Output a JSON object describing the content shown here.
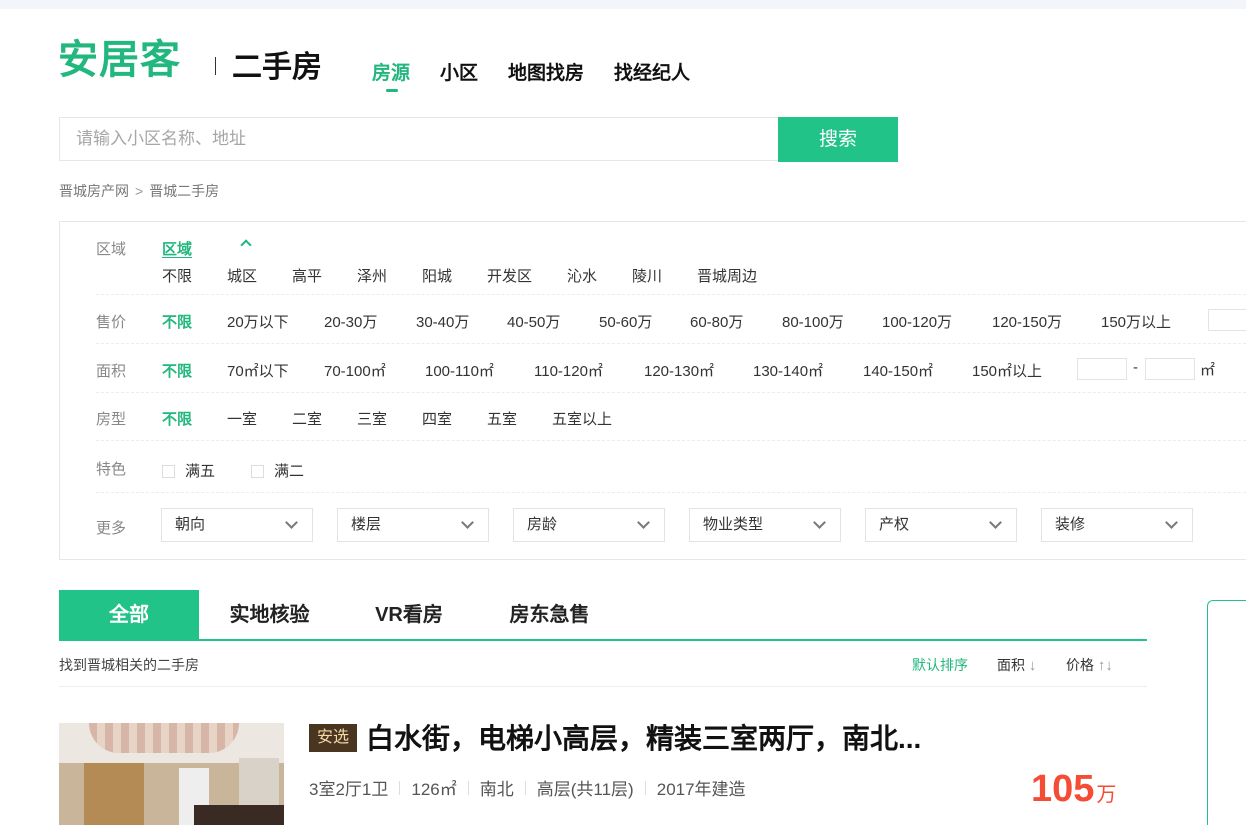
{
  "header": {
    "logo": "安居客",
    "subtitle": "二手房",
    "nav": [
      {
        "label": "房源",
        "active": true
      },
      {
        "label": "小区",
        "active": false
      },
      {
        "label": "地图找房",
        "active": false
      },
      {
        "label": "找经纪人",
        "active": false
      }
    ]
  },
  "search": {
    "placeholder": "请输入小区名称、地址",
    "button_label": "搜索"
  },
  "breadcrumb": [
    "晋城房产网",
    "晋城二手房"
  ],
  "breadcrumb_sep": ">",
  "filters": {
    "region": {
      "label": "区域",
      "tab": "区域",
      "options": [
        "不限",
        "城区",
        "高平",
        "泽州",
        "阳城",
        "开发区",
        "沁水",
        "陵川",
        "晋城周边"
      ]
    },
    "price": {
      "label": "售价",
      "options": [
        "不限",
        "20万以下",
        "20-30万",
        "30-40万",
        "40-50万",
        "50-60万",
        "60-80万",
        "80-100万",
        "100-120万",
        "120-150万",
        "150万以上"
      ]
    },
    "area": {
      "label": "面积",
      "options": [
        "不限",
        "70㎡以下",
        "70-100㎡",
        "100-110㎡",
        "110-120㎡",
        "120-130㎡",
        "130-140㎡",
        "140-150㎡",
        "150㎡以上"
      ],
      "range_dash": "-",
      "unit": "㎡"
    },
    "rooms": {
      "label": "房型",
      "options": [
        "不限",
        "一室",
        "二室",
        "三室",
        "四室",
        "五室",
        "五室以上"
      ]
    },
    "features": {
      "label": "特色",
      "options": [
        "满五",
        "满二"
      ]
    },
    "more": {
      "label": "更多",
      "selects": [
        "朝向",
        "楼层",
        "房龄",
        "物业类型",
        "产权",
        "装修"
      ]
    }
  },
  "tabs": [
    {
      "label": "全部",
      "active": true
    },
    {
      "label": "实地核验",
      "active": false
    },
    {
      "label": "VR看房",
      "active": false
    },
    {
      "label": "房东急售",
      "active": false
    }
  ],
  "results": {
    "summary": "找到晋城相关的二手房",
    "sort": {
      "default": "默认排序",
      "area": "面积",
      "price": "价格"
    }
  },
  "listing": {
    "tag": "安选",
    "title": "白水街，电梯小高层，精装三室两厅，南北...",
    "layout": "3室2厅1卫",
    "area": "126㎡",
    "orientation": "南北",
    "floor": "高层(共11层)",
    "built": "2017年建造",
    "price_value": "105",
    "price_unit": "万"
  },
  "colors": {
    "brand_green": "#21c389",
    "price_red": "#f54c36",
    "tag_bg": "#4a3520"
  }
}
